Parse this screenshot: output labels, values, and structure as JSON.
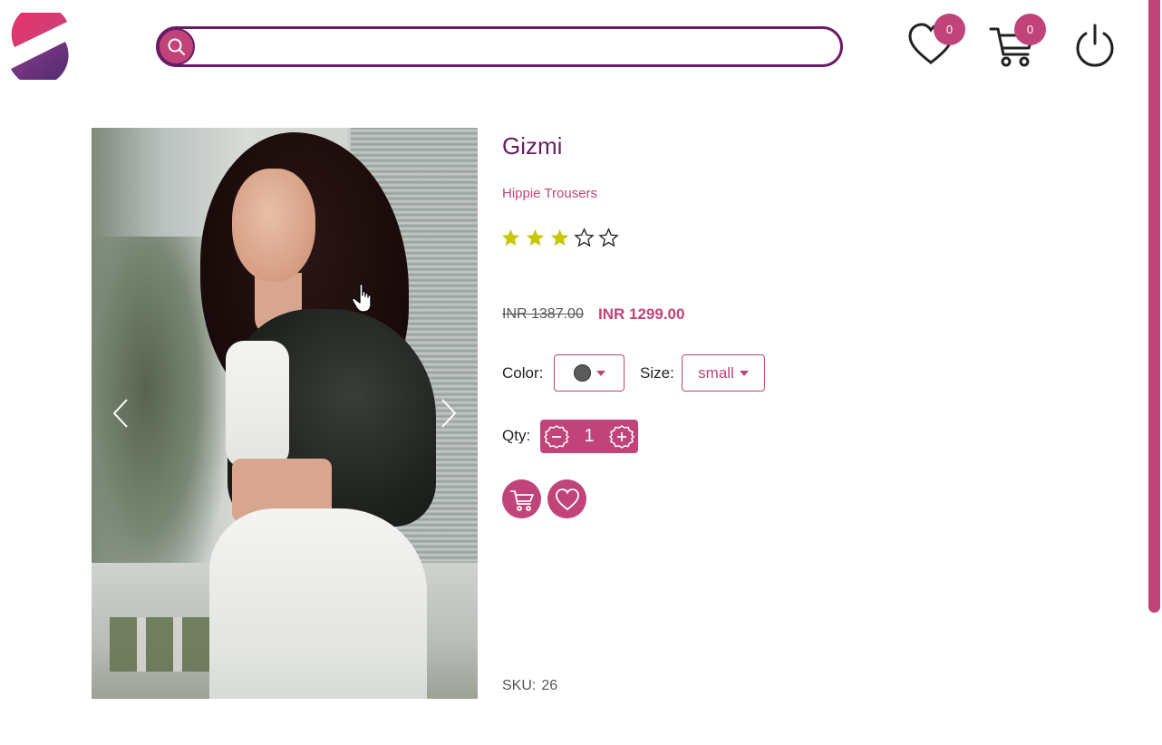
{
  "header": {
    "search": {
      "placeholder": "",
      "value": ""
    },
    "wishlist_count": "0",
    "cart_count": "0"
  },
  "product": {
    "name": "Gizmi",
    "category": "Hippie Trousers",
    "rating": 3,
    "rating_max": 5,
    "old_price": "INR 1387.00",
    "price": "INR 1299.00",
    "color_label": "Color:",
    "color_value": "#5a5a5a",
    "size_label": "Size:",
    "size_value": "small",
    "qty_label": "Qty:",
    "qty_value": "1",
    "sku_label": "SKU:",
    "sku_value": "26"
  },
  "colors": {
    "primary": "#6a1b66",
    "accent": "#c0447a",
    "star_filled": "#c8c80a"
  },
  "icons": [
    "logo-icon",
    "search-icon",
    "heart-icon",
    "cart-icon",
    "power-icon",
    "chevron-left-icon",
    "chevron-right-icon",
    "star-icon",
    "minus-icon",
    "plus-icon",
    "hand-cursor-icon"
  ]
}
